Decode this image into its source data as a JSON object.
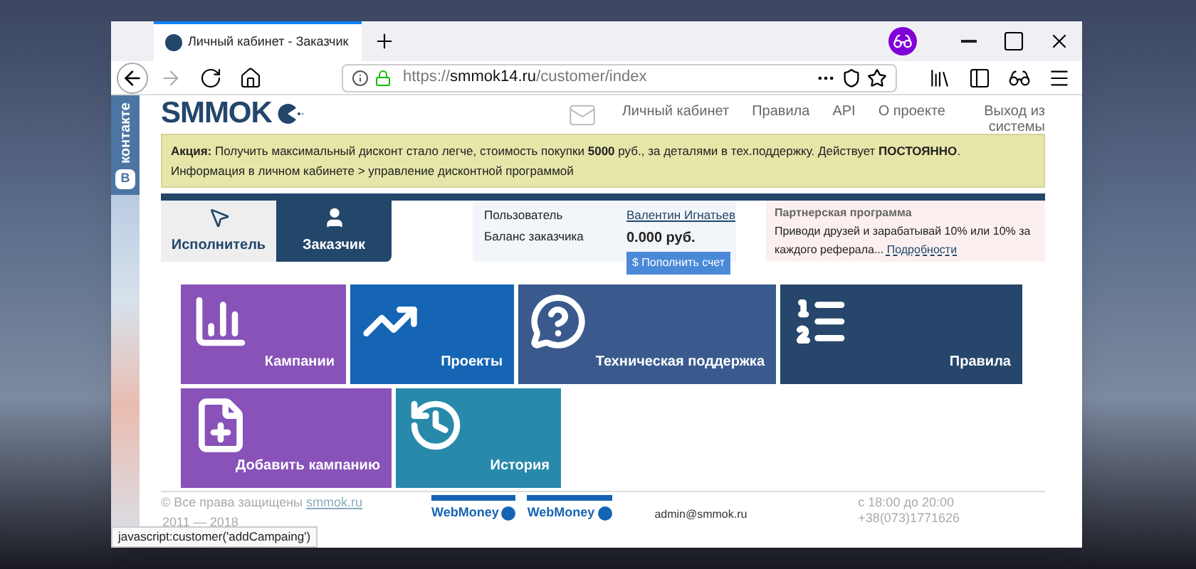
{
  "browser": {
    "tab_title": "Личный кабинет - Заказчик",
    "url": {
      "scheme": "https://",
      "host": "smmok14.ru",
      "path": "/customer/index"
    }
  },
  "side_widget": {
    "logo": "В",
    "label": "контакте"
  },
  "header": {
    "logo": "SMMOK",
    "nav": [
      "Личный кабинет",
      "Правила",
      "API",
      "О проекте",
      "Выход из системы"
    ]
  },
  "promo": "**Акция:** Получить максимальный дисконт стало легче, стоимость покупки **5000** руб., за деталями в тех.поддержку. Действует **ПОСТОЯННО**. Информация в личном кабинете > управление дисконтной программой",
  "role_tabs": [
    {
      "label": "Исполнитель",
      "selected": false,
      "kind": "worker"
    },
    {
      "label": "Заказчик",
      "selected": true,
      "kind": "customer"
    }
  ],
  "account": {
    "user_label": "Пользователь",
    "user_name": "Валентин Игнатьев",
    "balance_label": "Баланс заказчика",
    "balance": "0.000 руб.",
    "topup_button": "$ Пополнить счет"
  },
  "partner": {
    "title": "Партнерская программа",
    "text": "Приводи друзей и зарабатывай 10% или 10% за каждого реферала...",
    "link": "Подробности"
  },
  "tiles": [
    {
      "label": "Кампании",
      "color": "#8852b8",
      "kind": "bars"
    },
    {
      "label": "Проекты",
      "color": "#1565b4",
      "kind": "trend"
    },
    {
      "label": "Техническая поддержка",
      "color": "#3a5a8e",
      "kind": "help"
    },
    {
      "label": "Правила",
      "color": "#27466b",
      "kind": "list"
    },
    {
      "label": "Добавить кампанию",
      "color": "#8852b8",
      "kind": "add"
    },
    {
      "label": "История",
      "color": "#2889ab",
      "kind": "history"
    }
  ],
  "footer": {
    "copyright": "© Все права защищены",
    "site_link": "smmok.ru",
    "years": "2011 — 2018",
    "payments": [
      "WebMoney",
      "WebMoney"
    ],
    "email": "admin@smmok.ru",
    "hours": "с 18:00 до 20:00",
    "phone": "+38(073)1771626"
  },
  "status_url": "javascript:customer('addCampaing')"
}
